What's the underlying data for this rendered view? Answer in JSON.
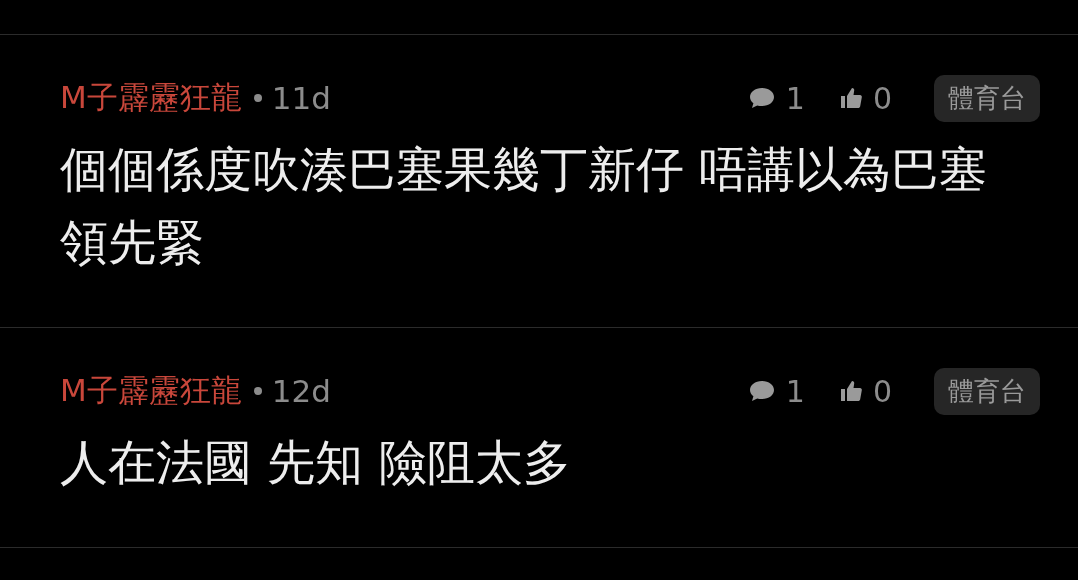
{
  "posts": [
    {
      "author": "M子霹靂狂龍",
      "age": "11d",
      "comments": "1",
      "likes": "0",
      "tag": "體育台",
      "body": "個個係度吹湊巴塞果幾丁新仔 唔講以為巴塞領先緊"
    },
    {
      "author": "M子霹靂狂龍",
      "age": "12d",
      "comments": "1",
      "likes": "0",
      "tag": "體育台",
      "body": "人在法國 先知 險阻太多"
    }
  ]
}
